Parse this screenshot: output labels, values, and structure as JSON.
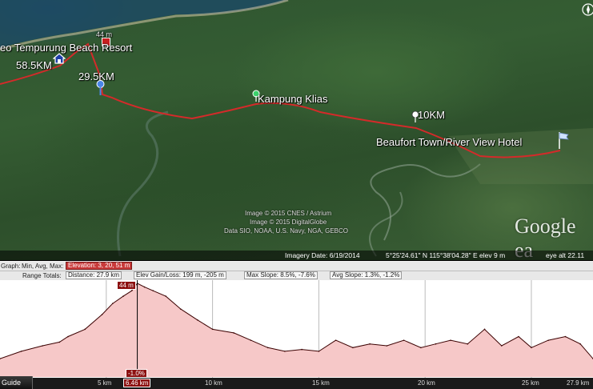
{
  "map": {
    "places": {
      "beach_resort": "eo Tempurung Beach Resort",
      "kampung": "Kampung Klias",
      "beaufort": "Beaufort Town/River View Hotel"
    },
    "markers": {
      "d58": "58.5KM",
      "d29": "29.5KM",
      "d10": "10KM",
      "elev_top": "44 m"
    },
    "credits": {
      "line1": "Image © 2015 CNES / Astrium",
      "line2": "Image © 2015 DigitalGlobe",
      "line3": "Data SIO, NOAA, U.S. Navy, NGA, GEBCO"
    },
    "logo": "Google ea",
    "status": {
      "imagery_date": "Imagery Date: 6/19/2014",
      "coords": "5°25'24.61\" N  115°38'04.28\" E  elev    9 m",
      "eye_alt": "eye alt  22.11"
    }
  },
  "profile": {
    "row1": {
      "graph": "Graph:",
      "min_avg_max": "Min, Avg, Max:",
      "elevation": "Elevation: 3, 20, 51 m"
    },
    "row2": {
      "range_totals": "Range Totals:",
      "distance": "Distance: 27.9 km",
      "elev_gain": "Elev Gain/Loss: 199 m, -205 m",
      "max_slope": "Max Slope: 8.5%, -7.6%",
      "avg_slope": "Avg Slope: 1.3%, -1.2%"
    },
    "tooltip_top": "44 m",
    "tooltip_slope": "-1.0%",
    "axis": {
      "guide": "Guide",
      "t5": "5 km",
      "cursor": "6.46 km",
      "t10": "10 km",
      "t15": "15 km",
      "t20": "20 km",
      "t25": "25 km",
      "t27": "27.9 km"
    }
  },
  "colors": {
    "route": "#d42a2a",
    "profile_fill": "#f6c8c8",
    "profile_line": "#3a0000",
    "highlight": "#c93a3a"
  },
  "chart_data": {
    "type": "area",
    "xlabel": "",
    "ylabel": "",
    "x_unit": "km",
    "y_unit": "m",
    "xlim": [
      0,
      27.9
    ],
    "ylim": [
      0,
      51
    ],
    "x": [
      0,
      1,
      2,
      2.8,
      3.2,
      4,
      4.8,
      5.3,
      5.8,
      6.2,
      6.46,
      6.8,
      7.2,
      7.8,
      8.5,
      9.3,
      10,
      11,
      11.8,
      12.6,
      13.4,
      14.2,
      15,
      15.8,
      16.6,
      17.4,
      18.2,
      19,
      19.8,
      20.5,
      21.2,
      22,
      22.8,
      23.6,
      24.4,
      25,
      25.8,
      26.6,
      27.3,
      27.9
    ],
    "y": [
      10,
      14,
      17,
      19,
      22,
      26,
      34,
      40,
      44,
      47,
      51,
      49,
      47,
      44,
      37,
      31,
      26,
      24,
      20,
      16,
      14,
      15,
      14,
      20,
      16,
      18,
      17,
      20,
      16,
      18,
      20,
      18,
      26,
      17,
      22,
      16,
      20,
      22,
      18,
      10
    ]
  }
}
